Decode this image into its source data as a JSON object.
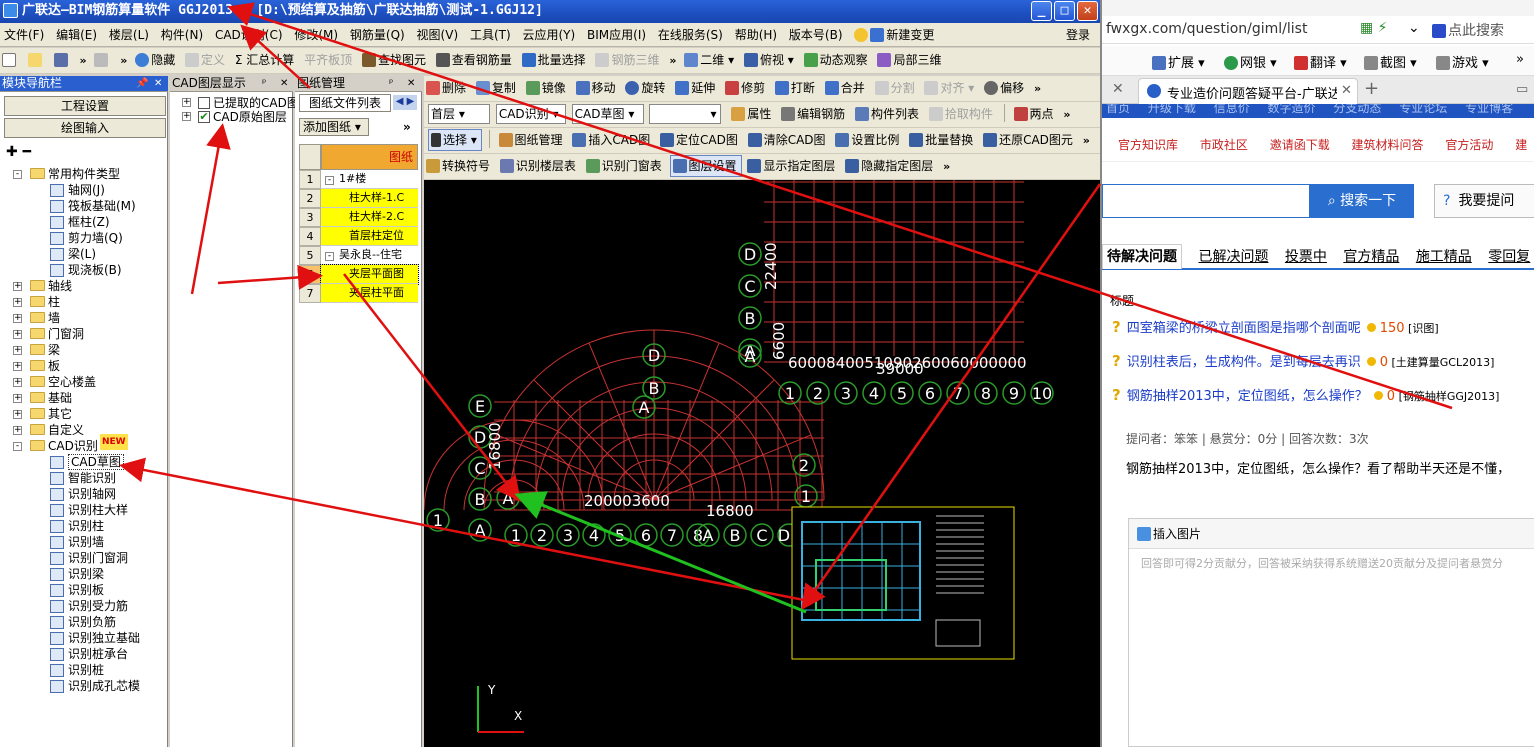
{
  "app": {
    "title": "广联达—BIM钢筋算量软件 GGJ2013 - [D:\\预结算及抽筋\\广联达抽筋\\测试-1.GGJ12]",
    "window_controls": [
      "_",
      "□",
      "✕"
    ]
  },
  "menu": {
    "items": [
      "文件(F)",
      "编辑(E)",
      "楼层(L)",
      "构件(N)",
      "CAD识别(C)",
      "修改(M)",
      "钢筋量(Q)",
      "视图(V)",
      "工具(T)",
      "云应用(Y)",
      "BIM应用(I)",
      "在线服务(S)",
      "帮助(H)",
      "版本号(B)",
      "新建变更"
    ],
    "login": "登录"
  },
  "toolbar1": {
    "items": [
      "隐藏",
      "定义",
      "Σ 汇总计算",
      "平齐板顶",
      "查找图元",
      "查看钢筋量",
      "批量选择",
      "钢筋三维",
      "二维",
      "俯视",
      "动态观察",
      "局部三维"
    ]
  },
  "toolbar2": {
    "items": [
      "删除",
      "复制",
      "镜像",
      "移动",
      "旋转",
      "延伸",
      "修剪",
      "打断",
      "合并",
      "分割",
      "对齐",
      "偏移"
    ]
  },
  "toolbar3": {
    "floor": "首层",
    "mode": "CAD识别",
    "type": "CAD草图",
    "items": [
      "属性",
      "编辑钢筋",
      "构件列表",
      "拾取构件",
      "两点"
    ]
  },
  "toolbar4": {
    "items": [
      "选择",
      "图纸管理",
      "插入CAD图",
      "定位CAD图",
      "清除CAD图",
      "设置比例",
      "批量替换",
      "还原CAD图元"
    ]
  },
  "toolbar5": {
    "items": [
      "转换符号",
      "识别楼层表",
      "识别门窗表",
      "图层设置",
      "显示指定图层",
      "隐藏指定图层"
    ]
  },
  "nav": {
    "title": "模块导航栏",
    "btn_project": "工程设置",
    "btn_draw": "绘图输入",
    "tree": [
      {
        "label": "常用构件类型",
        "level": 0,
        "kind": "folder",
        "exp": "-"
      },
      {
        "label": "轴网(J)",
        "level": 1,
        "kind": "item"
      },
      {
        "label": "筏板基础(M)",
        "level": 1,
        "kind": "item"
      },
      {
        "label": "框柱(Z)",
        "level": 1,
        "kind": "item"
      },
      {
        "label": "剪力墙(Q)",
        "level": 1,
        "kind": "item"
      },
      {
        "label": "梁(L)",
        "level": 1,
        "kind": "item"
      },
      {
        "label": "现浇板(B)",
        "level": 1,
        "kind": "item"
      },
      {
        "label": "轴线",
        "level": 0,
        "kind": "folder",
        "exp": "+"
      },
      {
        "label": "柱",
        "level": 0,
        "kind": "folder",
        "exp": "+"
      },
      {
        "label": "墙",
        "level": 0,
        "kind": "folder",
        "exp": "+"
      },
      {
        "label": "门窗洞",
        "level": 0,
        "kind": "folder",
        "exp": "+"
      },
      {
        "label": "梁",
        "level": 0,
        "kind": "folder",
        "exp": "+"
      },
      {
        "label": "板",
        "level": 0,
        "kind": "folder",
        "exp": "+"
      },
      {
        "label": "空心楼盖",
        "level": 0,
        "kind": "folder",
        "exp": "+"
      },
      {
        "label": "基础",
        "level": 0,
        "kind": "folder",
        "exp": "+"
      },
      {
        "label": "其它",
        "level": 0,
        "kind": "folder",
        "exp": "+"
      },
      {
        "label": "自定义",
        "level": 0,
        "kind": "folder",
        "exp": "+"
      },
      {
        "label": "CAD识别",
        "level": 0,
        "kind": "folder",
        "exp": "-",
        "badge": "NEW"
      },
      {
        "label": "CAD草图",
        "level": 1,
        "kind": "item",
        "selected": true
      },
      {
        "label": "智能识别",
        "level": 1,
        "kind": "item"
      },
      {
        "label": "识别轴网",
        "level": 1,
        "kind": "item"
      },
      {
        "label": "识别柱大样",
        "level": 1,
        "kind": "item"
      },
      {
        "label": "识别柱",
        "level": 1,
        "kind": "item"
      },
      {
        "label": "识别墙",
        "level": 1,
        "kind": "item"
      },
      {
        "label": "识别门窗洞",
        "level": 1,
        "kind": "item"
      },
      {
        "label": "识别梁",
        "level": 1,
        "kind": "item"
      },
      {
        "label": "识别板",
        "level": 1,
        "kind": "item"
      },
      {
        "label": "识别受力筋",
        "level": 1,
        "kind": "item"
      },
      {
        "label": "识别负筋",
        "level": 1,
        "kind": "item"
      },
      {
        "label": "识别独立基础",
        "level": 1,
        "kind": "item"
      },
      {
        "label": "识别桩承台",
        "level": 1,
        "kind": "item"
      },
      {
        "label": "识别桩",
        "level": 1,
        "kind": "item"
      },
      {
        "label": "识别成孔芯模",
        "level": 1,
        "kind": "item"
      }
    ]
  },
  "cadlayer": {
    "title": "CAD图层显示",
    "items": [
      {
        "label": "已提取的CAD图层",
        "checked": false
      },
      {
        "label": "CAD原始图层",
        "checked": true
      }
    ]
  },
  "drawings": {
    "title": "图纸管理",
    "tab": "图纸文件列表",
    "add_label": "添加图纸",
    "header_col": "图纸",
    "rows": [
      {
        "n": "1",
        "label": "1#楼",
        "exp": "-",
        "hl": false
      },
      {
        "n": "2",
        "label": "柱大样-1.C",
        "hl": true
      },
      {
        "n": "3",
        "label": "柱大样-2.C",
        "hl": true
      },
      {
        "n": "4",
        "label": "首层柱定位",
        "hl": true
      },
      {
        "n": "5",
        "label": "吴永良--住宅",
        "exp": "-",
        "hl": false
      },
      {
        "n": "6",
        "label": "夹层平面图",
        "hl": true,
        "selected": true
      },
      {
        "n": "7",
        "label": "夹层柱平面",
        "hl": true
      }
    ]
  },
  "canvas": {
    "grid_labels_a": [
      "D",
      "C",
      "B",
      "A"
    ],
    "grid_labels_b": [
      "E",
      "D",
      "C",
      "B",
      "A"
    ],
    "grid_numbers_a": [
      "1",
      "2",
      "3",
      "4",
      "5",
      "6",
      "7",
      "8",
      "9",
      "10"
    ],
    "grid_numbers_b": [
      "1",
      "2",
      "3",
      "4",
      "5",
      "6",
      "7",
      "8"
    ],
    "grid_numbers_c": [
      "A",
      "B",
      "C",
      "DE"
    ],
    "dim_top": "6000840051090260060000000",
    "dim_top2": "39000",
    "dim_left": "16800",
    "dim_bottom": "16800",
    "dim_bottom2": "200003600",
    "dim_vert": "22400",
    "dim_vert2": "6600",
    "ucs_x": "X",
    "ucs_y": "Y"
  },
  "browser": {
    "url": "fwxgx.com/question/giml/list",
    "search_hint": "点此搜索",
    "bookmarks": [
      "扩展",
      "网银",
      "翻译",
      "截图",
      "游戏"
    ],
    "tab_title": "专业造价问题答疑平台-广联达",
    "site_nav": [
      "首页",
      "升级下载",
      "信息价",
      "数字造价",
      "分支动态",
      "专业论坛",
      "专业博客"
    ],
    "subnav": [
      "官方知识库",
      "市政社区",
      "邀请函下载",
      "建筑材料问答",
      "官方活动",
      "建"
    ],
    "search_btn": "搜索一下",
    "ask_btn": "我要提问",
    "tabs": [
      "待解决问题",
      "已解决问题",
      "投票中",
      "官方精品",
      "施工精品",
      "零回复"
    ],
    "list_header": "标题",
    "questions": [
      {
        "title": "四室箱梁的桥梁立剖面图是指哪个剖面呢",
        "score": "150",
        "tag": "[识图]"
      },
      {
        "title": "识别柱表后，生成构件。是到每层去再识",
        "score": "0",
        "tag": "[土建算量GCL2013]"
      },
      {
        "title": "钢筋抽样2013中，定位图纸，怎么操作？",
        "score": "0",
        "tag": "[钢筋抽样GGJ2013]"
      }
    ],
    "meta": "提问者：笨笨  |  悬赏分：0分  |  回答次数：3次",
    "body": "钢筋抽样2013中，定位图纸，怎么操作？看了帮助半天还是不懂，",
    "insert_image": "插入图片",
    "answer_hint": "回答即可得2分贡献分，回答被采纳获得系统赠送20贡献分及提问者悬赏分"
  },
  "colors": {
    "arrow_red": "#e01010",
    "arrow_green": "#20c020",
    "highlight_yellow": "#ffff00",
    "cad_grid_red": "#c83232",
    "link_blue": "#1a3cc8",
    "site_red": "#c81e1e"
  }
}
